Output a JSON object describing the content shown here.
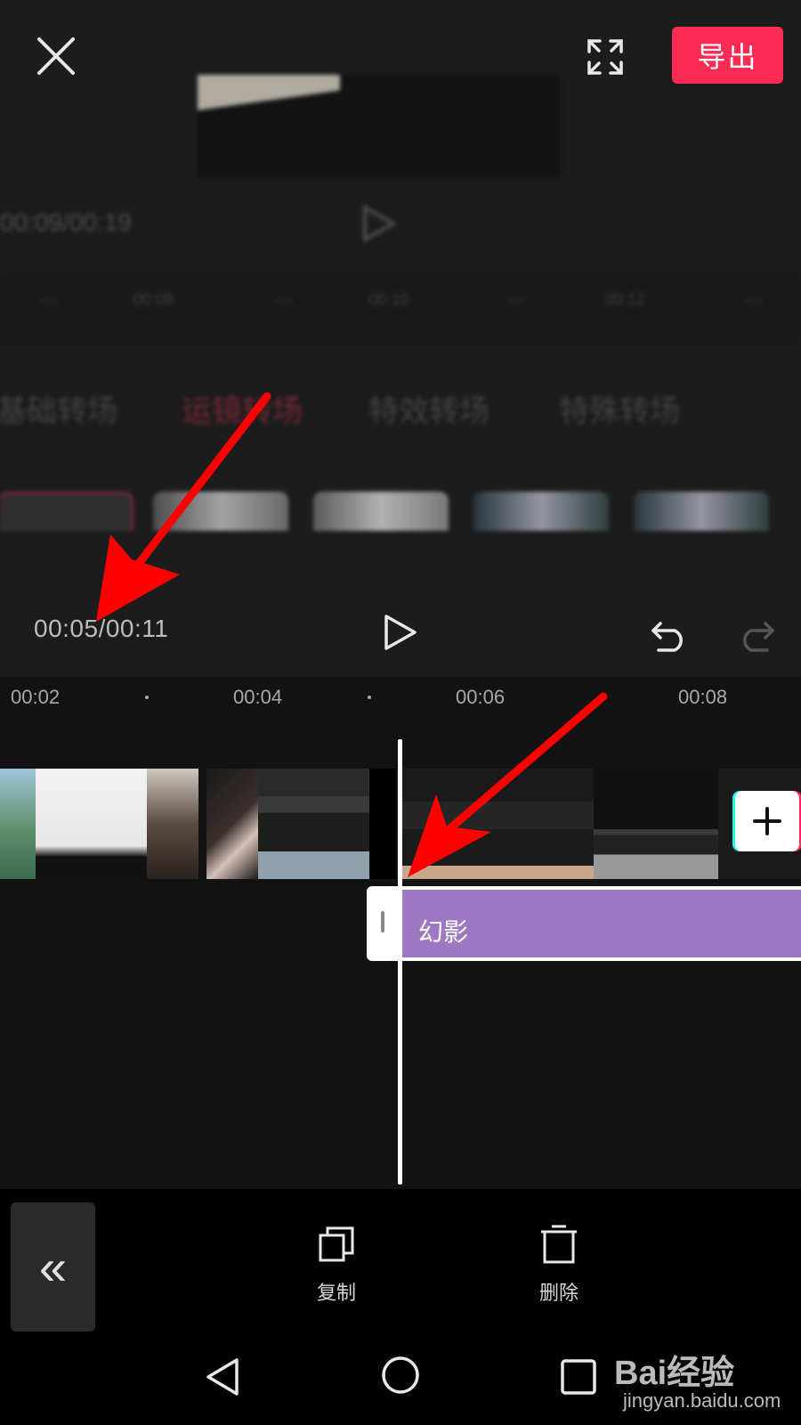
{
  "topbar": {
    "export_label": "导出"
  },
  "blurred_preview": {
    "time": "00:09/00:19",
    "ruler_ticks": [
      "00:08",
      "00:10",
      "00:12"
    ],
    "tabs": [
      "基础转场",
      "运镜转场",
      "特效转场",
      "特殊转场"
    ],
    "active_tab_index": 1
  },
  "player": {
    "time_display": "00:05/00:11"
  },
  "timeline": {
    "ticks": [
      "00:02",
      "00:04",
      "00:06",
      "00:08"
    ]
  },
  "effect_track": {
    "label": "幻影",
    "color": "#9f78c4"
  },
  "toolbar": {
    "copy_label": "复制",
    "delete_label": "删除"
  },
  "watermark": {
    "brand": "Bai经验",
    "url": "jingyan.baidu.com"
  },
  "colors": {
    "accent": "#fe2c55",
    "background": "#121212",
    "annotation_arrow": "#ff0000"
  }
}
